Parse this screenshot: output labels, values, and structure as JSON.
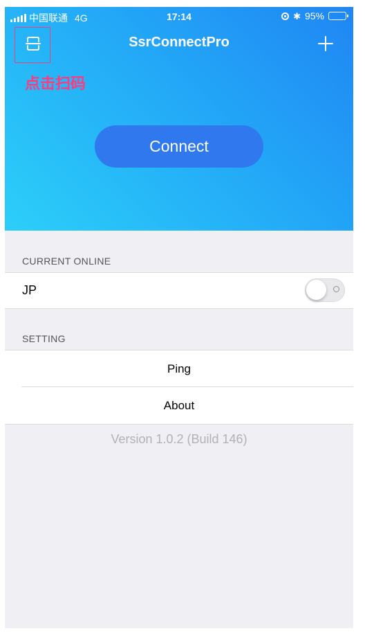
{
  "status_bar": {
    "carrier": "中国联通",
    "network": "4G",
    "time": "17:14",
    "battery": "95%",
    "battery_level": 0.95
  },
  "nav": {
    "title": "SsrConnectPro",
    "left_icon": "scan-icon",
    "right_icon": "plus-icon"
  },
  "hint": "点击扫码",
  "connect_button": "Connect",
  "current_online": {
    "header": "CURRENT ONLINE",
    "server": "JP",
    "toggle_on": false
  },
  "settings": {
    "header": "SETTING",
    "items": [
      "Ping",
      "About"
    ]
  },
  "version": "Version 1.0.2 (Build 146)",
  "colors": {
    "gradient_start": "#2ccff9",
    "gradient_end": "#1f86f3",
    "connect_button": "#2f78ee",
    "hint_text": "#ff3b7f",
    "background": "#efeff4"
  }
}
